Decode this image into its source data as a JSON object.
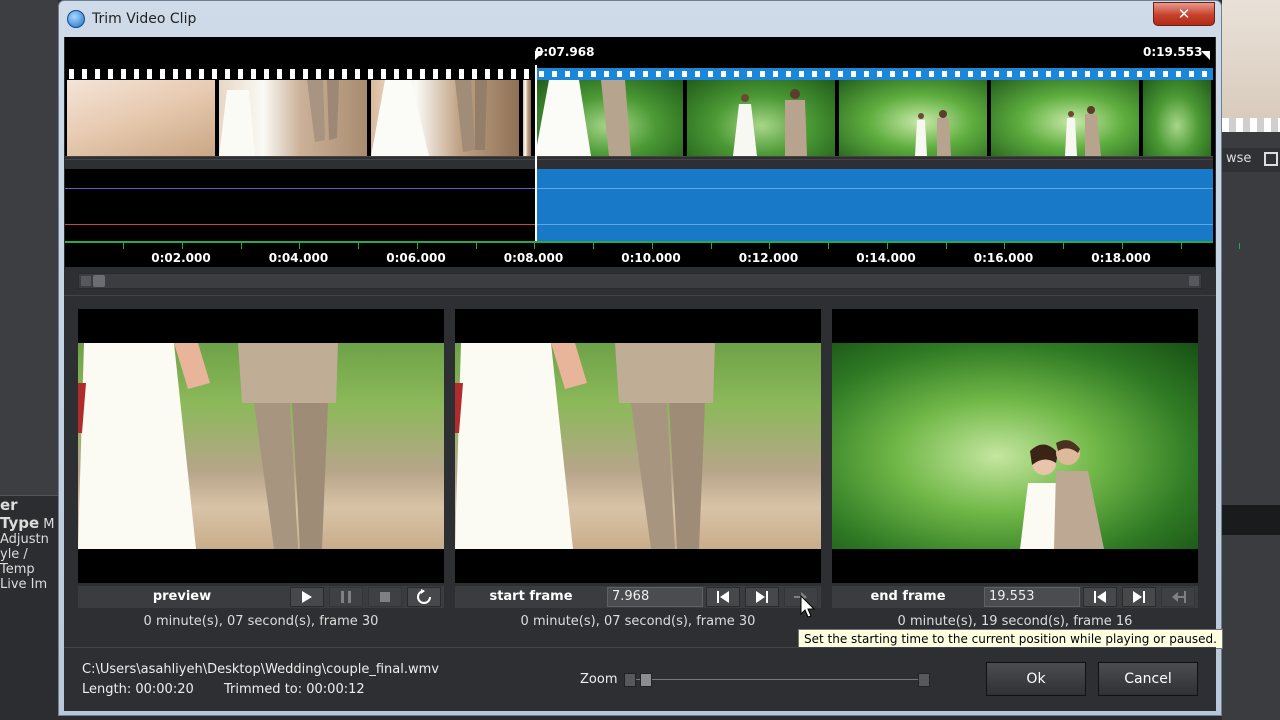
{
  "background": {
    "left_labels": [
      "er Type",
      "M",
      "Adjustn",
      "yle / Temp",
      "Live Im"
    ],
    "right_label": "wse"
  },
  "window": {
    "title": "Trim Video Clip",
    "close_label": "✕"
  },
  "timeline": {
    "start_marker": "0:07.968",
    "end_marker": "0:19.553",
    "ticks": [
      "0:02.000",
      "0:04.000",
      "0:06.000",
      "0:08.000",
      "0:10.000",
      "0:12.000",
      "0:14.000",
      "0:16.000",
      "0:18.000"
    ]
  },
  "panels": {
    "preview": {
      "label": "preview",
      "info": "0 minute(s), 07 second(s), frame 30"
    },
    "start": {
      "label": "start frame",
      "value": "7.968",
      "info": "0 minute(s), 07 second(s), frame 30"
    },
    "end": {
      "label": "end frame",
      "value": "19.553",
      "info": "0 minute(s), 19 second(s), frame 16"
    }
  },
  "tooltip": "Set the starting time to the current position while playing or paused.",
  "footer": {
    "path": "C:\\Users\\asahliyeh\\Desktop\\Wedding\\couple_final.wmv",
    "length": "Length: 00:00:20",
    "trimmed": "Trimmed to: 00:00:12",
    "zoom_label": "Zoom",
    "ok_label": "Ok",
    "cancel_label": "Cancel"
  },
  "colors": {
    "selection": "#1879c9",
    "ruler": "#2aa84a",
    "close": "#c6412c"
  }
}
